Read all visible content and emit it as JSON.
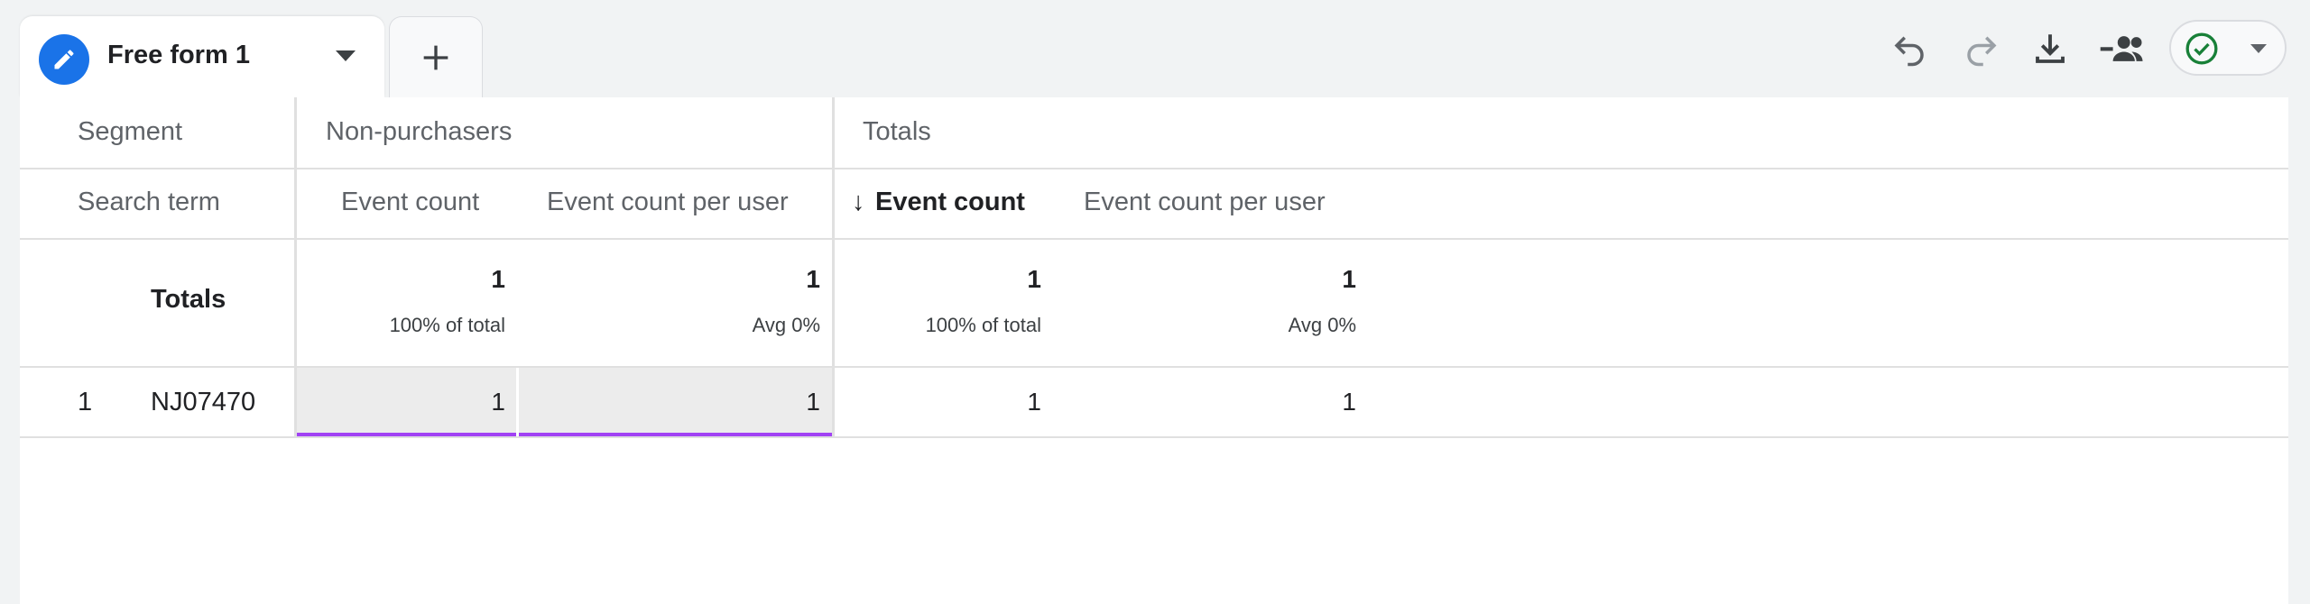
{
  "tab": {
    "title": "Free form 1"
  },
  "toolbar": {
    "icons": [
      "undo-icon",
      "redo-icon",
      "download-icon",
      "share-icon",
      "check-circle-icon"
    ],
    "accent": "#1a73e8",
    "status_color": "#188038"
  },
  "table": {
    "row_dim_header": "Segment",
    "search_term_header": "Search term",
    "segments": [
      "Non-purchasers",
      "Totals"
    ],
    "columns": [
      "Event count",
      "Event count per user",
      "Event count",
      "Event count per user"
    ],
    "sort_arrow": "↓",
    "totals": {
      "label": "Totals",
      "values": [
        "1",
        "1",
        "1",
        "1"
      ],
      "subs": [
        "100% of total",
        "Avg 0%",
        "100% of total",
        "Avg 0%"
      ]
    },
    "rows": [
      {
        "index": "1",
        "term": "NJ07470",
        "values": [
          "1",
          "1",
          "1",
          "1"
        ]
      }
    ],
    "highlight_color": "#a142f4"
  }
}
